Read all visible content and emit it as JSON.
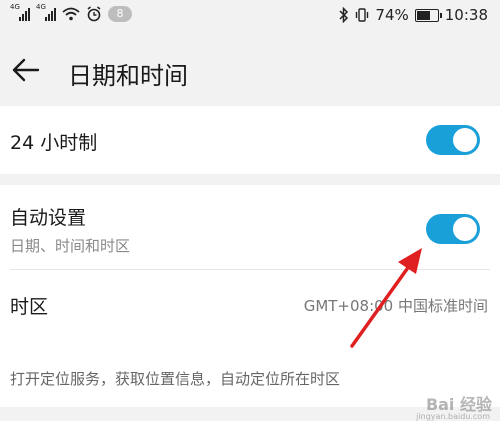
{
  "status_bar": {
    "sim1": "4G",
    "sim2": "4G",
    "notification_count": "8",
    "battery_percent_text": "74%",
    "battery_level": 0.74,
    "time": "10:38"
  },
  "header": {
    "title": "日期和时间",
    "back_icon": "arrow-left-icon"
  },
  "settings": {
    "hour24": {
      "label": "24 小时制",
      "enabled": true
    },
    "auto_set": {
      "label": "自动设置",
      "sublabel": "日期、时间和时区",
      "enabled": true
    },
    "timezone": {
      "label": "时区",
      "value": "GMT+08:00 中国标准时间"
    },
    "location_hint": "打开定位服务，获取位置信息，自动定位所在时区"
  },
  "watermark": {
    "text": "Bai 经验",
    "subtext": "jingyan.baidu.com"
  },
  "colors": {
    "accent": "#1aa0d8",
    "annotation_arrow": "#e02020"
  }
}
